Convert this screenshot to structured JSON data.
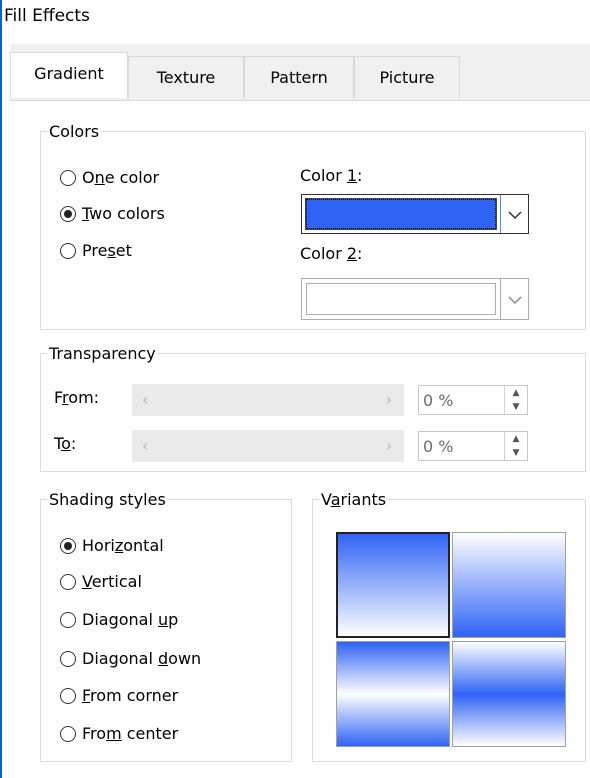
{
  "window": {
    "title": "Fill Effects"
  },
  "tabs": [
    "Gradient",
    "Texture",
    "Pattern",
    "Picture"
  ],
  "colors_group": {
    "legend": "Colors",
    "options": [
      {
        "pre": "O",
        "key": "n",
        "post": "e color",
        "checked": false
      },
      {
        "pre": "",
        "key": "T",
        "post": "wo colors",
        "checked": true
      },
      {
        "pre": "Pre",
        "key": "s",
        "post": "et",
        "checked": false
      }
    ],
    "color1_label_pre": "Color ",
    "color1_label_key": "1",
    "color1_label_post": ":",
    "color2_label_pre": "Color ",
    "color2_label_key": "2",
    "color2_label_post": ":",
    "color1_value": "#2f63f5",
    "color2_value": "#ffffff"
  },
  "transparency": {
    "legend": "Transparency",
    "from_pre": "F",
    "from_key": "r",
    "from_post": "om:",
    "to_pre": "T",
    "to_key": "o",
    "to_post": ":",
    "from_value": "0 %",
    "to_value": "0 %"
  },
  "shading": {
    "legend": "Shading styles",
    "options": [
      {
        "pre": "Hori",
        "key": "z",
        "post": "ontal",
        "checked": true
      },
      {
        "pre": "",
        "key": "V",
        "post": "ertical",
        "checked": false
      },
      {
        "pre": "Diagonal ",
        "key": "u",
        "post": "p",
        "checked": false
      },
      {
        "pre": "Diagonal ",
        "key": "d",
        "post": "own",
        "checked": false
      },
      {
        "pre": "",
        "key": "F",
        "post": "rom corner",
        "checked": false
      },
      {
        "pre": "Fro",
        "key": "m",
        "post": " center",
        "checked": false
      }
    ]
  },
  "variants": {
    "legend_pre": "V",
    "legend_key": "a",
    "legend_post": "riants"
  },
  "accent_color": "#2f63f5"
}
